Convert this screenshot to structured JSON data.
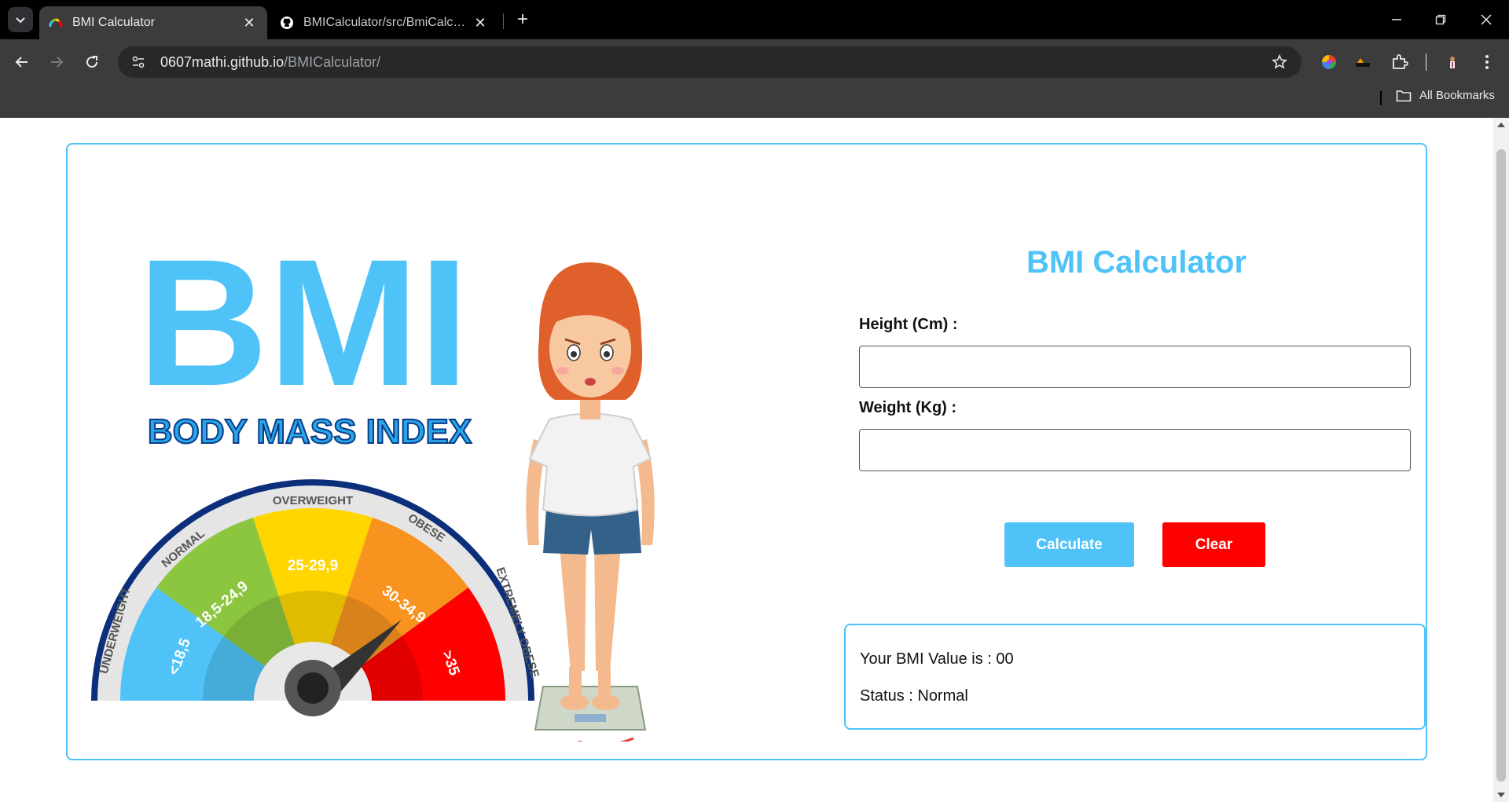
{
  "browser": {
    "tabs": [
      {
        "title": "BMI Calculator",
        "active": true
      },
      {
        "title": "BMICalculator/src/BmiCalculator",
        "active": false
      }
    ],
    "url_host": "0607mathi.github.io",
    "url_path": "/BMICalculator/",
    "bookmarks_label": "All Bookmarks"
  },
  "illustration": {
    "logo_big": "BMI",
    "logo_sub": "BODY MASS INDEX",
    "gauge_labels": {
      "underweight": "UNDERWEIGHT",
      "normal": "NORMAL",
      "overweight": "OVERWEIGHT",
      "obese": "OBESE",
      "extremely_obese": "EXTREMELY OBESE"
    },
    "gauge_ranges": {
      "underweight": "<18,5",
      "normal": "18,5-24,9",
      "overweight": "25-29,9",
      "obese": "30-34,9",
      "extremely_obese": ">35"
    },
    "colors": {
      "underweight": "#4fc3f7",
      "normal": "#8cc63f",
      "overweight": "#ffd600",
      "obese": "#f7931e",
      "extremely_obese": "#ff0000"
    }
  },
  "app": {
    "title": "BMI Calculator",
    "height_label": "Height (Cm) :",
    "height_value": "",
    "weight_label": "Weight (Kg) :",
    "weight_value": "",
    "calculate_label": "Calculate",
    "clear_label": "Clear",
    "bmi_text": "Your BMI Value is : 00",
    "status_text": "Status : Normal",
    "accent_color": "#4fc3f7",
    "danger_color": "#ff0000"
  }
}
